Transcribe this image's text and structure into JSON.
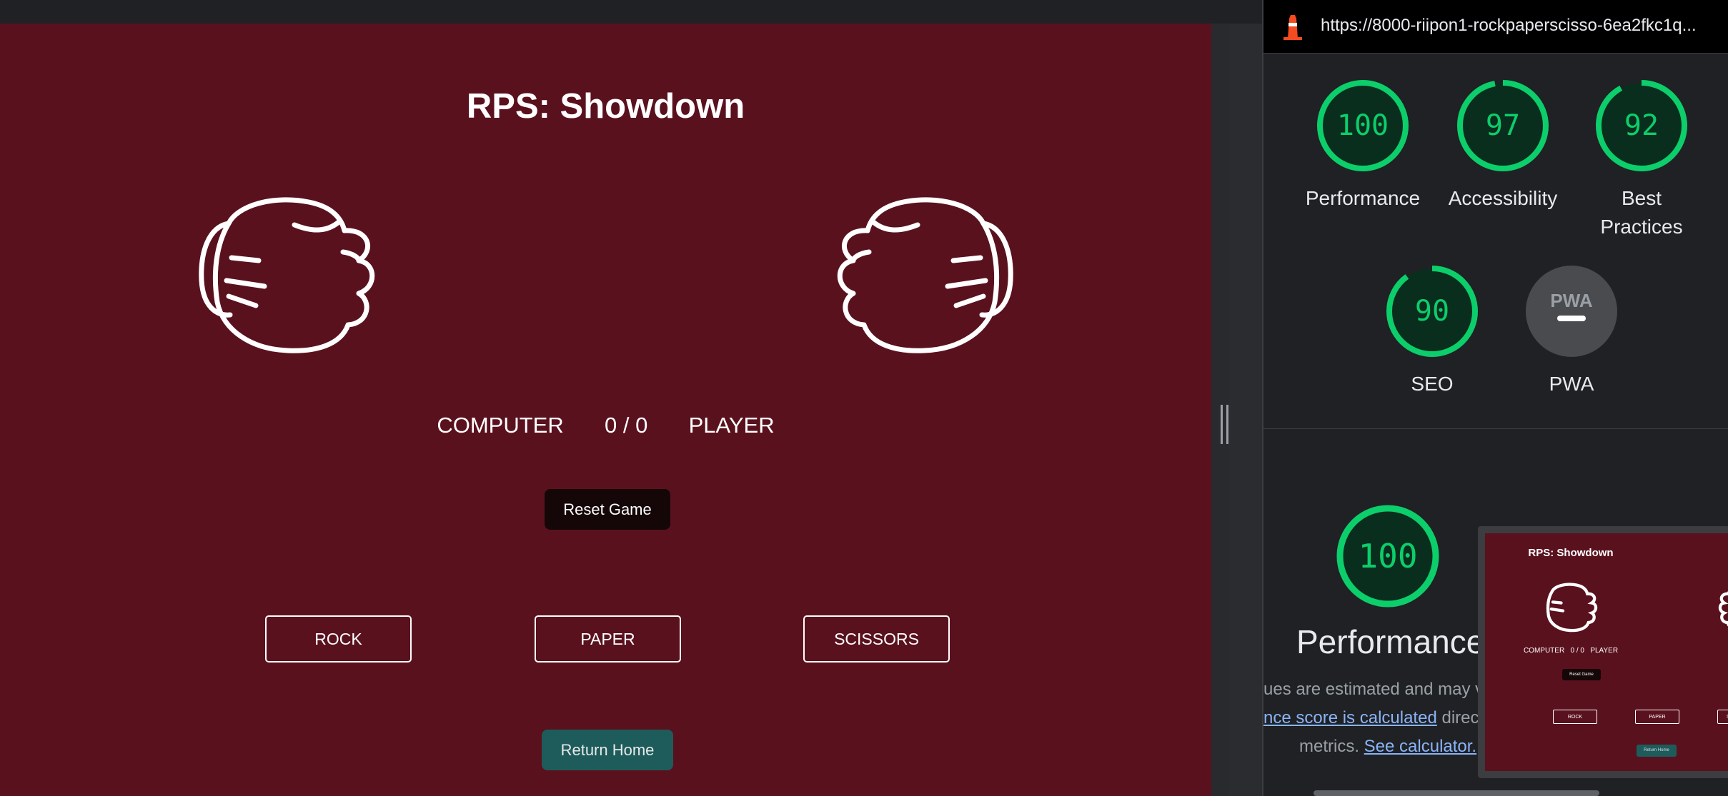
{
  "game": {
    "title": "RPS: Showdown",
    "computer_label": "COMPUTER",
    "score": "0 / 0",
    "player_label": "PLAYER",
    "reset_label": "Reset Game",
    "choices": [
      "ROCK",
      "PAPER",
      "SCISSORS"
    ],
    "home_label": "Return Home",
    "colors": {
      "background": "#5a111e",
      "reset_button": "#150607",
      "home_button": "#1e5c5c"
    }
  },
  "panel": {
    "url": "https://8000-riipon1-rockpaperscisso-6ea2fkc1q...",
    "scores": [
      {
        "value": "100",
        "label": "Performance",
        "fraction": 1.0
      },
      {
        "value": "97",
        "label": "Accessibility",
        "fraction": 0.97
      },
      {
        "value": "92",
        "label": "Best Practices",
        "label_line1": "Best",
        "label_line2": "Practices",
        "fraction": 0.92
      },
      {
        "value": "90",
        "label": "SEO",
        "fraction": 0.9
      }
    ],
    "pwa": {
      "badge": "PWA",
      "label": "PWA"
    },
    "main": {
      "value": "100",
      "label": "Performance",
      "fraction": 1.0
    },
    "desc_line1": "ues are estimated and may va",
    "desc_link": "nce score is calculated",
    "desc_line2_rest": "direct",
    "desc_line3_prefix": "metrics.",
    "desc_line3_link": "See calculator.",
    "colors": {
      "pass": "#0cce6b",
      "panel_bg": "#202124",
      "link": "#8ab4f8"
    }
  }
}
